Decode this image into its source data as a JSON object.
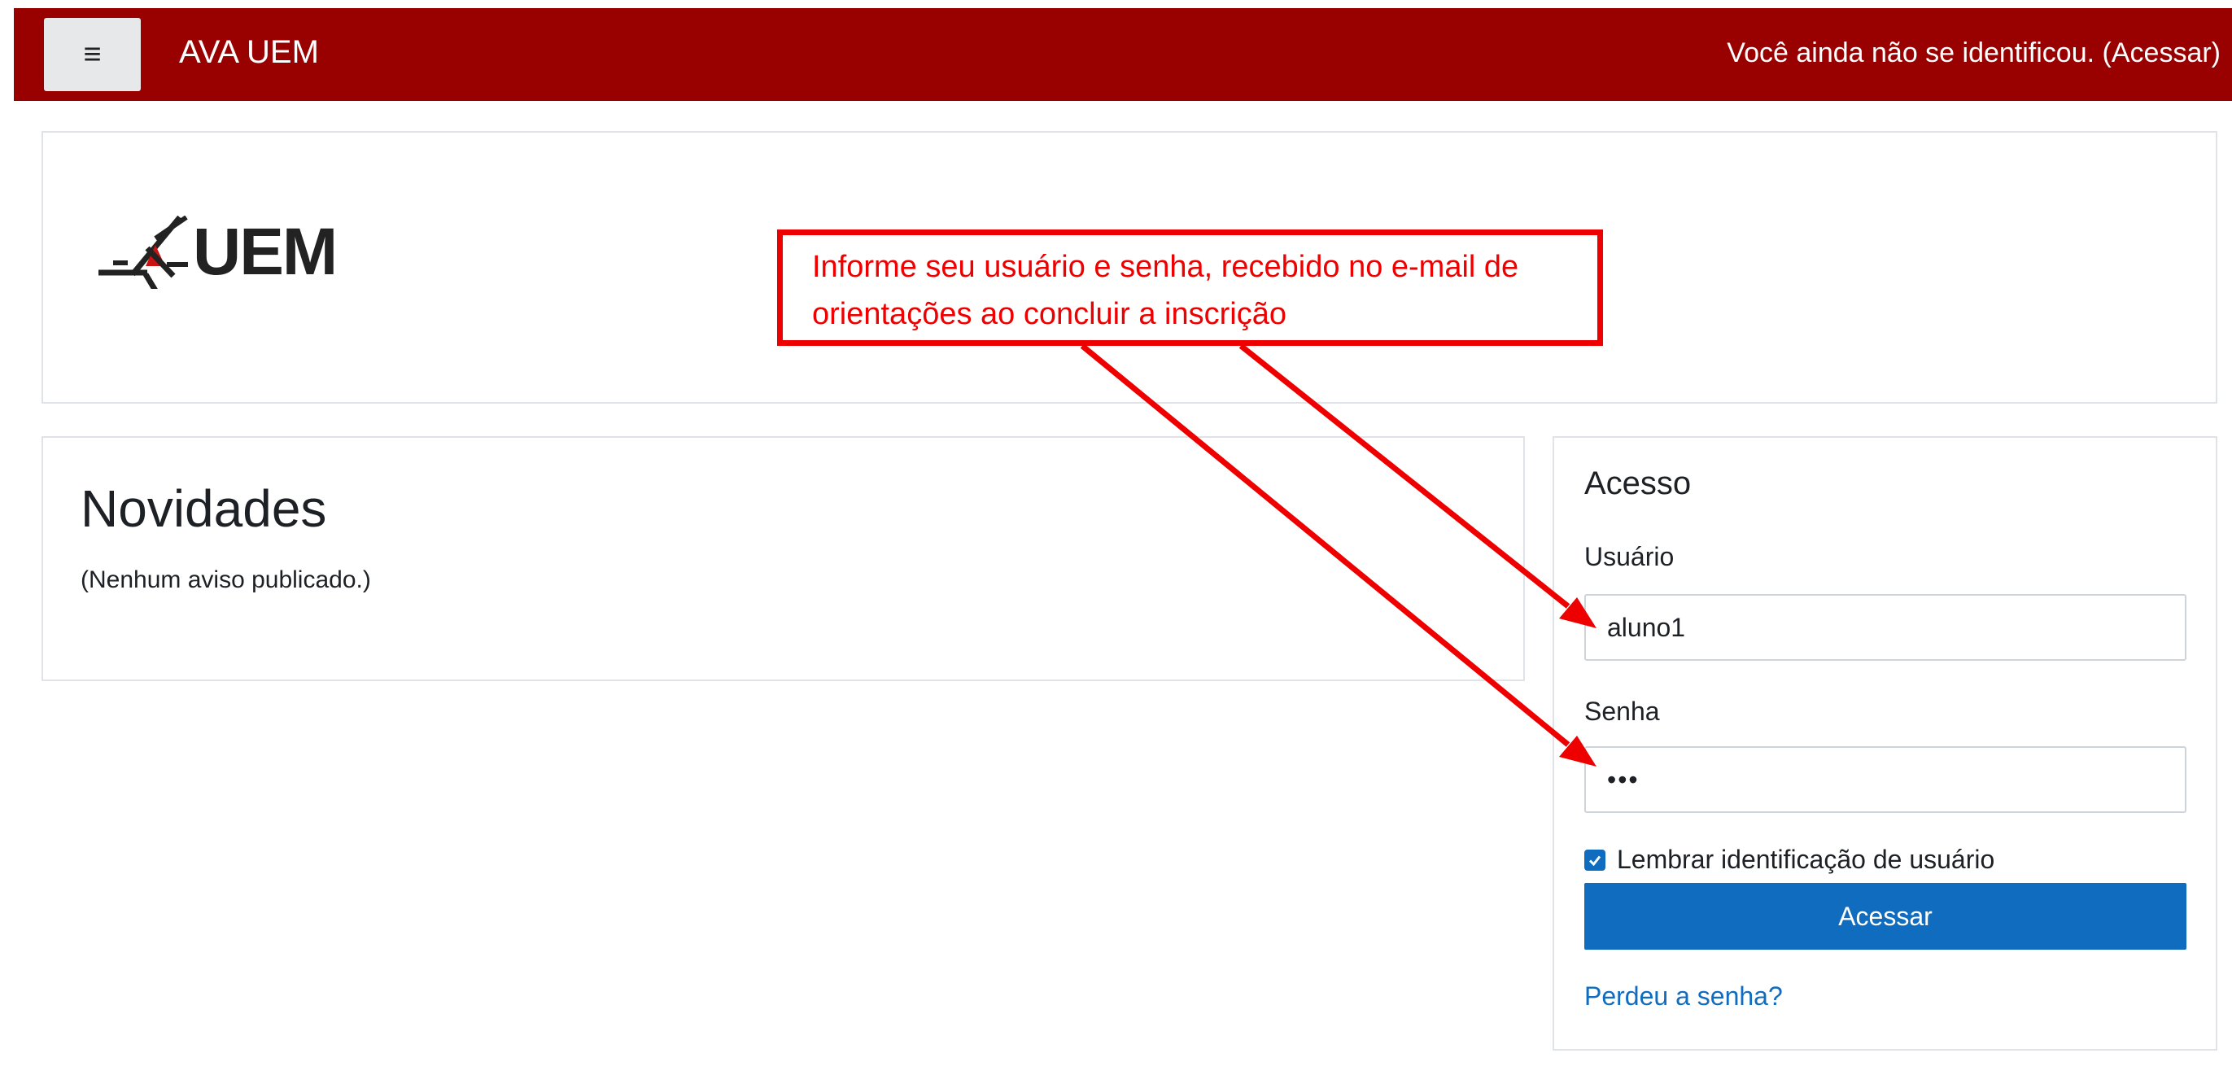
{
  "navbar": {
    "menu_icon": "hamburger-icon",
    "site_name": "AVA UEM",
    "login_status": "Você ainda não se identificou.",
    "login_link": "(Acessar)",
    "background_color": "#990000"
  },
  "header": {
    "logo_text": "UEM"
  },
  "annotation": {
    "line1": "Informe seu usuário e senha, recebido no e-mail de",
    "line2": "orientações ao concluir a inscrição",
    "color": "#ee0000"
  },
  "news": {
    "title": "Novidades",
    "empty_text": "(Nenhum aviso publicado.)"
  },
  "login": {
    "title": "Acesso",
    "username_label": "Usuário",
    "username_value": "aluno1",
    "password_label": "Senha",
    "password_value": "•••",
    "remember_label": "Lembrar identificação de usuário",
    "remember_checked": true,
    "submit_label": "Acessar",
    "forgot_label": "Perdeu a senha?",
    "accent_color": "#0f6cbf"
  }
}
